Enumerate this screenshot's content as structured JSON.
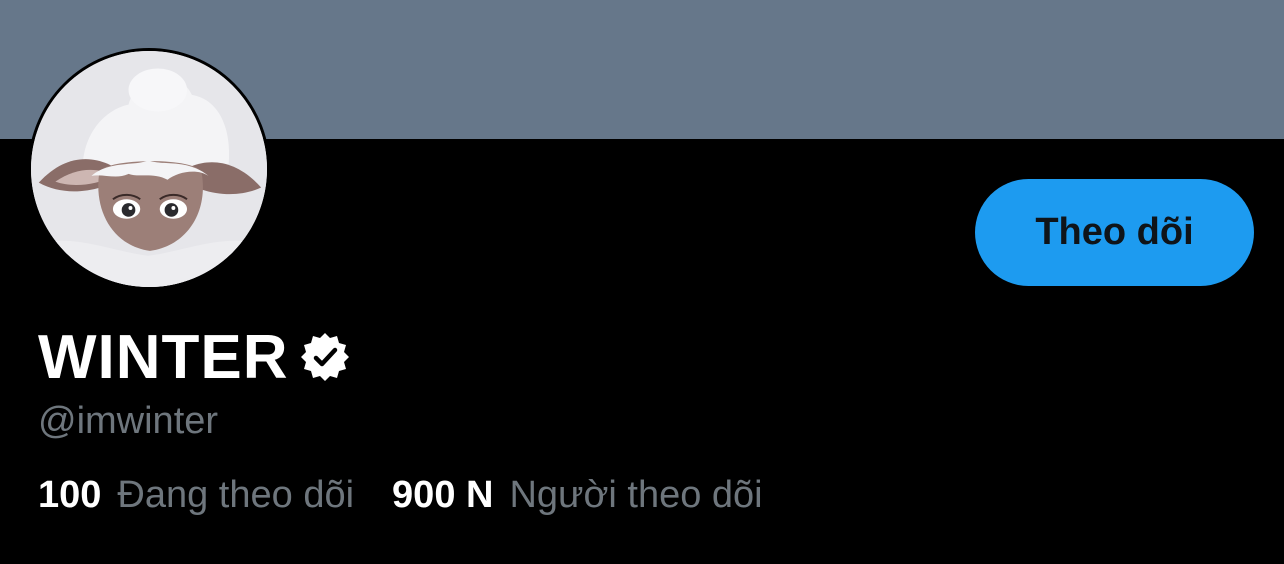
{
  "profile": {
    "display_name": "WINTER",
    "handle": "@imwinter",
    "verified": true,
    "follow_button_label": "Theo dõi",
    "following_count": "100",
    "following_label": "Đang theo dõi",
    "followers_count": "900 N",
    "followers_label": "Người theo dõi"
  },
  "icons": {
    "verified": "verified-badge-icon",
    "avatar": "deer-in-snow-avatar"
  },
  "colors": {
    "banner": "#66778a",
    "background": "#000000",
    "accent": "#1d9bf0",
    "secondary_text": "#6e767d",
    "primary_text": "#ffffff"
  }
}
